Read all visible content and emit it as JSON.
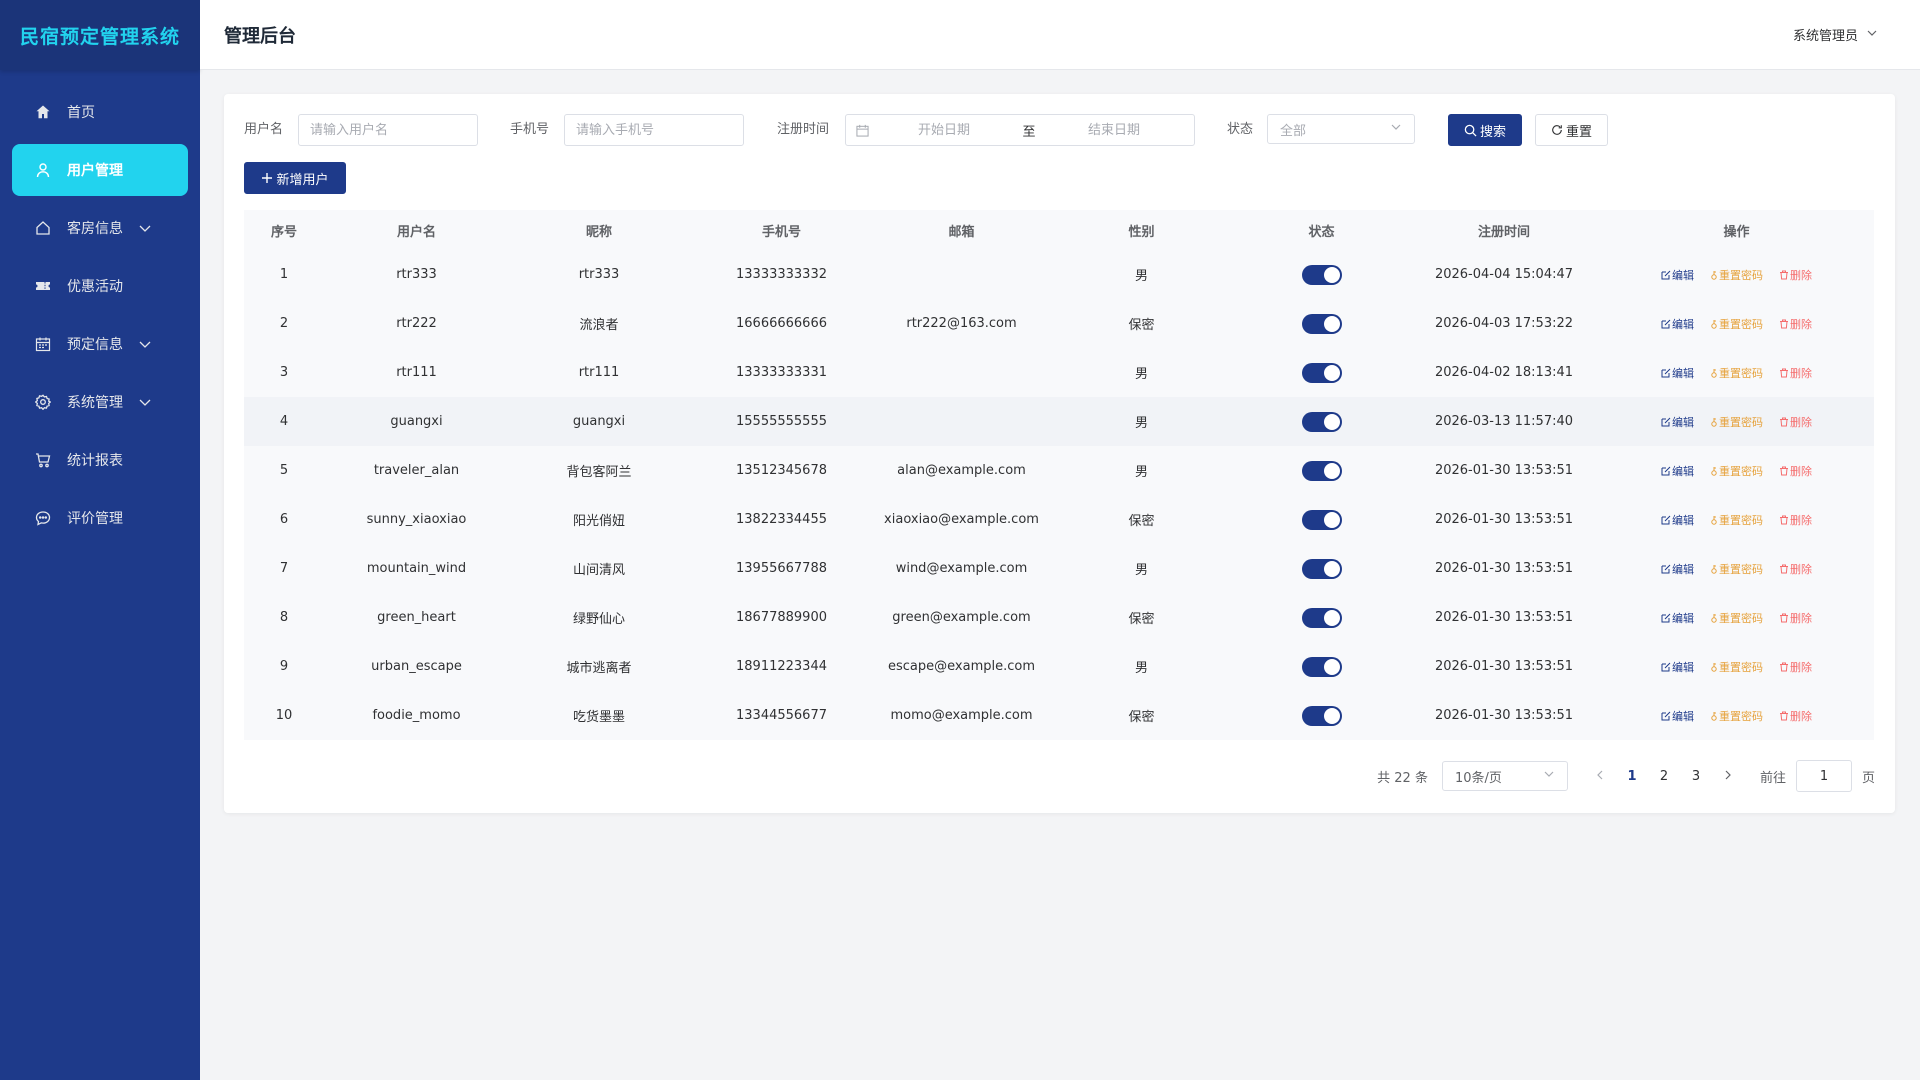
{
  "sidebar": {
    "brand": "民宿预定管理系统",
    "items": [
      {
        "label": "首页",
        "icon": "home-icon",
        "active": false,
        "expandable": false
      },
      {
        "label": "用户管理",
        "icon": "user-icon",
        "active": true,
        "expandable": false
      },
      {
        "label": "客房信息",
        "icon": "house-icon",
        "active": false,
        "expandable": true
      },
      {
        "label": "优惠活动",
        "icon": "ticket-icon",
        "active": false,
        "expandable": false
      },
      {
        "label": "预定信息",
        "icon": "calendar-icon",
        "active": false,
        "expandable": true
      },
      {
        "label": "系统管理",
        "icon": "gear-icon",
        "active": false,
        "expandable": true
      },
      {
        "label": "统计报表",
        "icon": "cart-icon",
        "active": false,
        "expandable": false
      },
      {
        "label": "评价管理",
        "icon": "comment-icon",
        "active": false,
        "expandable": false
      }
    ]
  },
  "header": {
    "title": "管理后台",
    "user": "系统管理员"
  },
  "filters": {
    "username_label": "用户名",
    "username_placeholder": "请输入用户名",
    "phone_label": "手机号",
    "phone_placeholder": "请输入手机号",
    "regtime_label": "注册时间",
    "start_placeholder": "开始日期",
    "range_sep": "至",
    "end_placeholder": "结束日期",
    "status_label": "状态",
    "status_value": "全部",
    "search_label": "搜索",
    "reset_label": "重置"
  },
  "actions": {
    "add_user": "新增用户"
  },
  "table": {
    "columns": [
      "序号",
      "用户名",
      "昵称",
      "手机号",
      "邮箱",
      "性别",
      "状态",
      "注册时间",
      "操作"
    ],
    "op_edit": "编辑",
    "op_reset": "重置密码",
    "op_delete": "删除",
    "rows": [
      {
        "no": "1",
        "username": "rtr333",
        "nickname": "rtr333",
        "phone": "13333333332",
        "email": "",
        "gender": "男",
        "enabled": true,
        "registered": "2026-04-04 15:04:47"
      },
      {
        "no": "2",
        "username": "rtr222",
        "nickname": "流浪者",
        "phone": "16666666666",
        "email": "rtr222@163.com",
        "gender": "保密",
        "enabled": true,
        "registered": "2026-04-03 17:53:22"
      },
      {
        "no": "3",
        "username": "rtr111",
        "nickname": "rtr111",
        "phone": "13333333331",
        "email": "",
        "gender": "男",
        "enabled": true,
        "registered": "2026-04-02 18:13:41"
      },
      {
        "no": "4",
        "username": "guangxi",
        "nickname": "guangxi",
        "phone": "15555555555",
        "email": "",
        "gender": "男",
        "enabled": true,
        "registered": "2026-03-13 11:57:40"
      },
      {
        "no": "5",
        "username": "traveler_alan",
        "nickname": "背包客阿兰",
        "phone": "13512345678",
        "email": "alan@example.com",
        "gender": "男",
        "enabled": true,
        "registered": "2026-01-30 13:53:51"
      },
      {
        "no": "6",
        "username": "sunny_xiaoxiao",
        "nickname": "阳光俏妞",
        "phone": "13822334455",
        "email": "xiaoxiao@example.com",
        "gender": "保密",
        "enabled": true,
        "registered": "2026-01-30 13:53:51"
      },
      {
        "no": "7",
        "username": "mountain_wind",
        "nickname": "山间清风",
        "phone": "13955667788",
        "email": "wind@example.com",
        "gender": "男",
        "enabled": true,
        "registered": "2026-01-30 13:53:51"
      },
      {
        "no": "8",
        "username": "green_heart",
        "nickname": "绿野仙心",
        "phone": "18677889900",
        "email": "green@example.com",
        "gender": "保密",
        "enabled": true,
        "registered": "2026-01-30 13:53:51"
      },
      {
        "no": "9",
        "username": "urban_escape",
        "nickname": "城市逃离者",
        "phone": "18911223344",
        "email": "escape@example.com",
        "gender": "男",
        "enabled": true,
        "registered": "2026-01-30 13:53:51"
      },
      {
        "no": "10",
        "username": "foodie_momo",
        "nickname": "吃货墨墨",
        "phone": "13344556677",
        "email": "momo@example.com",
        "gender": "保密",
        "enabled": true,
        "registered": "2026-01-30 13:53:51"
      }
    ]
  },
  "pagination": {
    "total": "共 22 条",
    "page_size": "10条/页",
    "pages": [
      "1",
      "2",
      "3"
    ],
    "current": "1",
    "goto_label": "前往",
    "goto_value": "1",
    "page_suffix": "页"
  },
  "colors": {
    "sidebar_bg": "#1e3a8a",
    "accent": "#22d3ee",
    "primary": "#1e3a8a",
    "warning": "#e6a23c",
    "danger": "#f56c6c"
  }
}
